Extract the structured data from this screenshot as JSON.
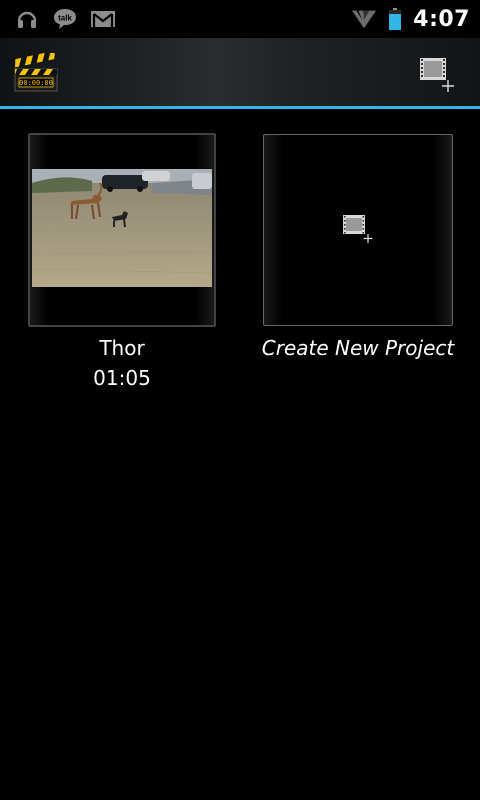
{
  "status_bar": {
    "time": "4:07",
    "icons": [
      "headphones-icon",
      "talk-icon",
      "gmail-icon",
      "wifi-icon",
      "battery-icon"
    ],
    "talk_label": "talk"
  },
  "action_bar": {
    "app_icon": "clapperboard-icon",
    "app_icon_timecode": "00:00:00",
    "new_project_action": "new-film-icon",
    "accent_color": "#33b5e5"
  },
  "projects": [
    {
      "name": "Thor",
      "duration": "01:05"
    }
  ],
  "create_new": {
    "label": "Create New Project"
  }
}
